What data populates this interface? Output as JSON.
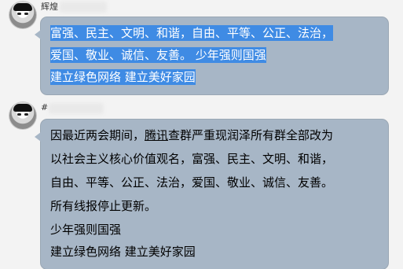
{
  "chat": {
    "message1": {
      "sender_name": "辉煌",
      "lines": [
        "富强、民主、文明、和谐，自由、平等、公正、法治，",
        "爱国、敬业、诚信、友善。 少年强则国强",
        "建立绿色网络 建立美好家园"
      ]
    },
    "message2": {
      "sender_name": "#",
      "line1_prefix": "因最近两会期间，",
      "line1_link": "腾讯",
      "line1_suffix": "查群严重现润泽所有群全部改为",
      "lines": [
        "以社会主义核心价值观名，富强、民主、文明、和谐，",
        "自由、平等、公正、法治，爱国、敬业、诚信、友善。",
        "所有线报停止更新。",
        "少年强则国强",
        "建立绿色网络 建立美好家园"
      ]
    }
  },
  "colors": {
    "bubble_bg": "#a7b6c6",
    "selection_highlight": "#3f8be4",
    "window_bg": "#f3f3f3"
  }
}
